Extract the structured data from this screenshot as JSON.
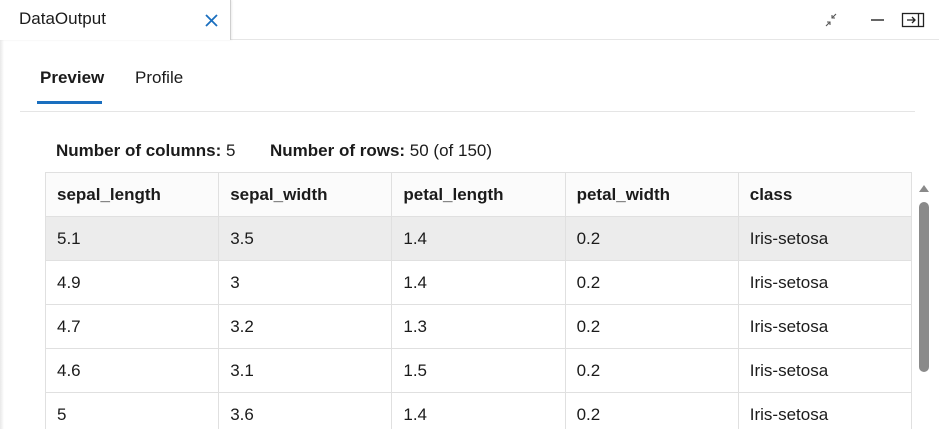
{
  "window": {
    "tab_title": "DataOutput",
    "controls": [
      "collapse-icon",
      "minimize-icon",
      "dock-panel-icon"
    ]
  },
  "tabs": [
    {
      "label": "Preview",
      "active": true
    },
    {
      "label": "Profile",
      "active": false
    }
  ],
  "summary": {
    "columns_label": "Number of columns:",
    "columns_value": "5",
    "rows_label": "Number of rows:",
    "rows_value": "50 (of 150)"
  },
  "table": {
    "headers": [
      "sepal_length",
      "sepal_width",
      "petal_length",
      "petal_width",
      "class"
    ],
    "rows": [
      [
        "5.1",
        "3.5",
        "1.4",
        "0.2",
        "Iris-setosa"
      ],
      [
        "4.9",
        "3",
        "1.4",
        "0.2",
        "Iris-setosa"
      ],
      [
        "4.7",
        "3.2",
        "1.3",
        "0.2",
        "Iris-setosa"
      ],
      [
        "4.6",
        "3.1",
        "1.5",
        "0.2",
        "Iris-setosa"
      ],
      [
        "5",
        "3.6",
        "1.4",
        "0.2",
        "Iris-setosa"
      ]
    ]
  },
  "colors": {
    "accent": "#1a6fbf",
    "selected_row": "#ececec",
    "scroll_thumb": "#8a8a8a"
  }
}
